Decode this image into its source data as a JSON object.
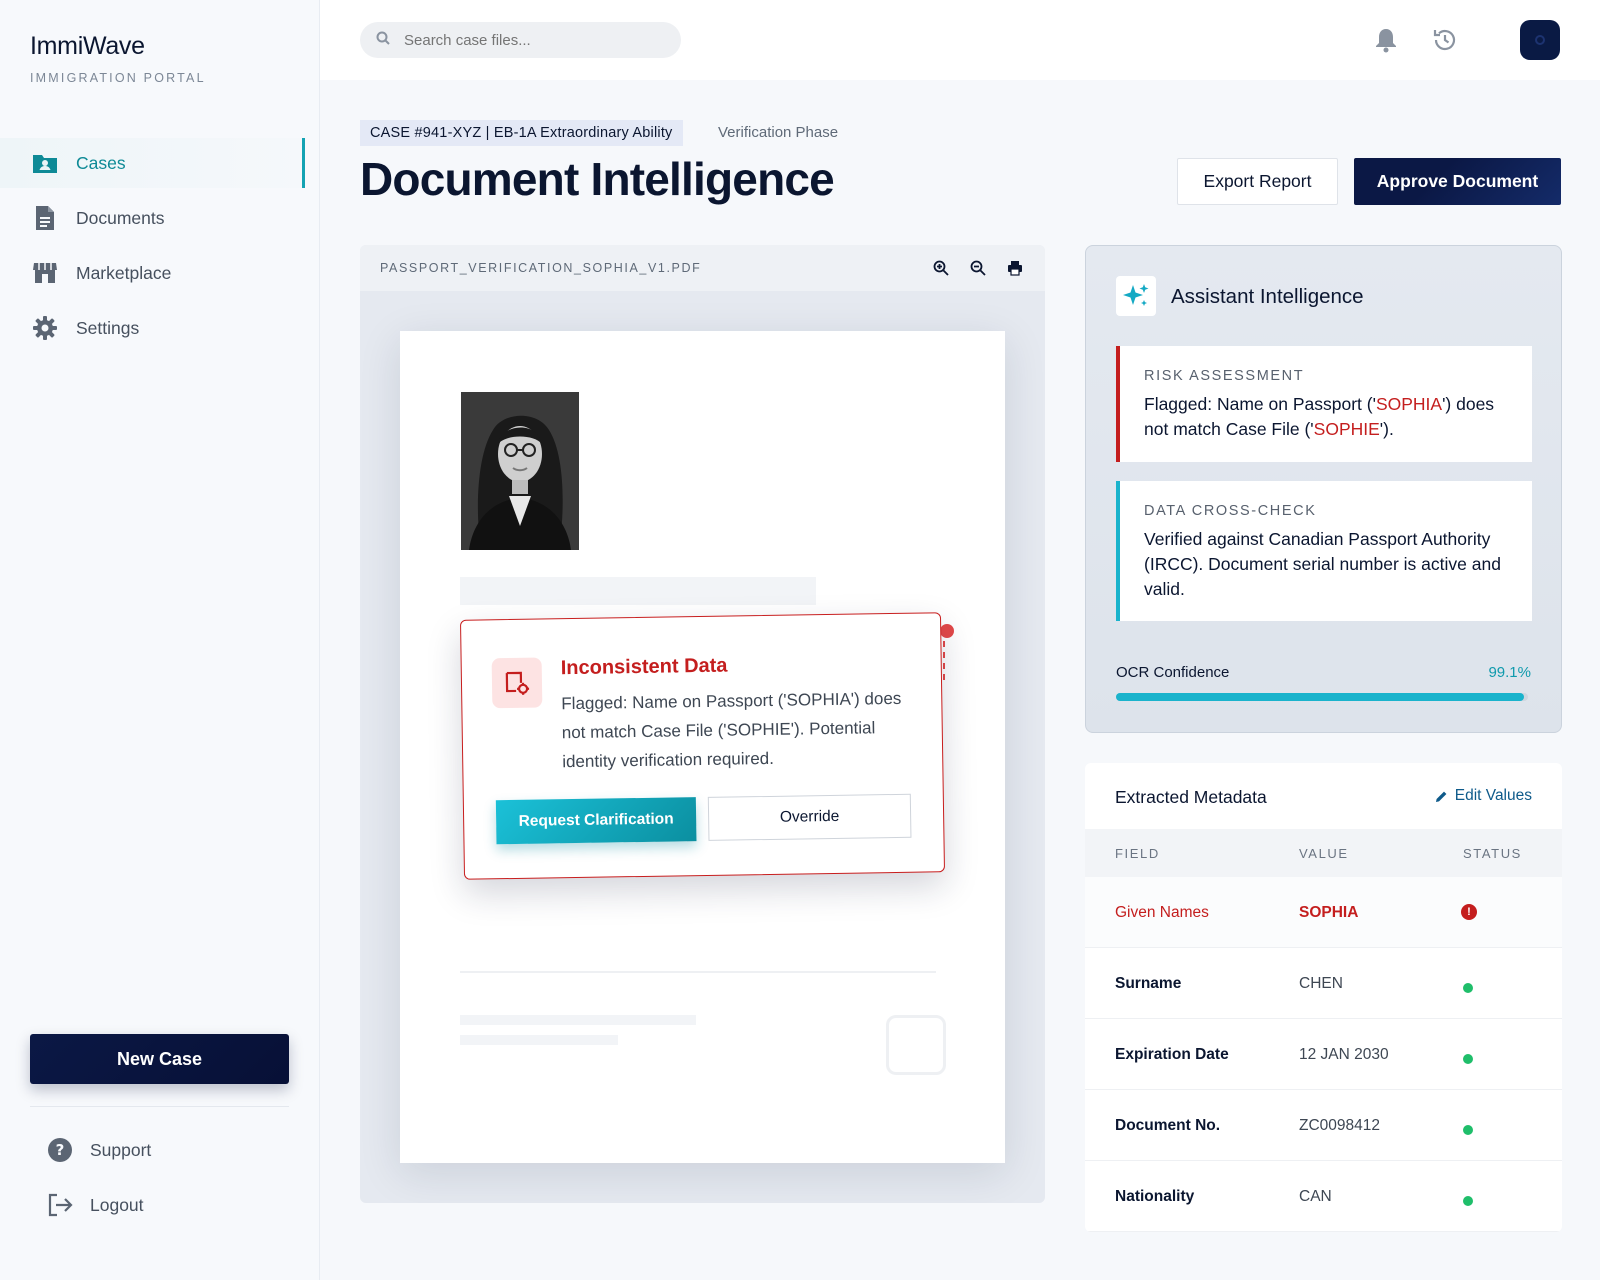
{
  "brand": {
    "name": "ImmiWave",
    "subtitle": "IMMIGRATION PORTAL"
  },
  "sidebar": {
    "items": [
      {
        "label": "Cases",
        "icon": "folder-user-icon",
        "active": true
      },
      {
        "label": "Documents",
        "icon": "document-icon",
        "active": false
      },
      {
        "label": "Marketplace",
        "icon": "storefront-icon",
        "active": false
      },
      {
        "label": "Settings",
        "icon": "gear-icon",
        "active": false
      }
    ],
    "new_case_label": "New Case",
    "support_label": "Support",
    "logout_label": "Logout"
  },
  "topbar": {
    "search_placeholder": "Search case files...",
    "icons": [
      "bell-icon",
      "history-icon",
      "avatar"
    ]
  },
  "header": {
    "case_tag": "CASE #941-XYZ | EB-1A Extraordinary Ability",
    "phase": "Verification Phase",
    "title": "Document Intelligence",
    "export_label": "Export Report",
    "approve_label": "Approve Document"
  },
  "viewer": {
    "filename": "PASSPORT_VERIFICATION_SOPHIA_V1.PDF",
    "tools": [
      "zoom-in-icon",
      "zoom-out-icon",
      "print-icon"
    ]
  },
  "alert": {
    "title": "Inconsistent Data",
    "body": "Flagged: Name on Passport ('SOPHIA') does not match Case File ('SOPHIE'). Potential identity verification required.",
    "primary_label": "Request Clarification",
    "secondary_label": "Override"
  },
  "assistant": {
    "title": "Assistant Intelligence",
    "risk": {
      "label": "RISK ASSESSMENT",
      "text_1": "Flagged: Name on Passport ('",
      "name_passport": "SOPHIA",
      "text_2": "') does not match Case File ('",
      "name_case": "SOPHIE",
      "text_3": "')."
    },
    "check": {
      "label": "DATA CROSS-CHECK",
      "text": "Verified against Canadian Passport Authority (IRCC). Document serial number is active and valid."
    },
    "ocr": {
      "label": "OCR Confidence",
      "value_text": "99.1%",
      "value": 0.991
    }
  },
  "metadata": {
    "title": "Extracted Metadata",
    "edit_label": "Edit Values",
    "columns": [
      "FIELD",
      "VALUE",
      "STATUS"
    ],
    "rows": [
      {
        "field": "Given Names",
        "value": "SOPHIA",
        "status": "error"
      },
      {
        "field": "Surname",
        "value": "CHEN",
        "status": "ok"
      },
      {
        "field": "Expiration Date",
        "value": "12 JAN 2030",
        "status": "ok"
      },
      {
        "field": "Document No.",
        "value": "ZC0098412",
        "status": "ok"
      },
      {
        "field": "Nationality",
        "value": "CAN",
        "status": "ok"
      }
    ]
  },
  "colors": {
    "accent": "#14a3b3",
    "navy": "#0b1845",
    "danger": "#c41e1e",
    "success": "#1fbe6a"
  }
}
